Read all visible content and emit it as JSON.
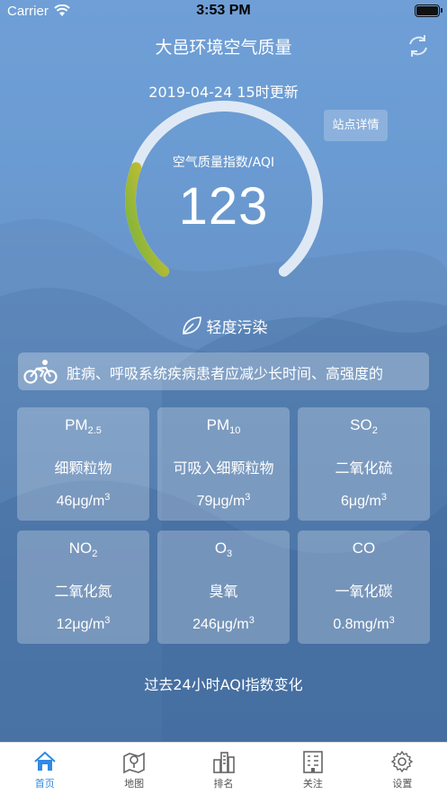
{
  "status_bar": {
    "carrier": "Carrier",
    "time": "3:53 PM"
  },
  "header": {
    "title": "大邑环境空气质量",
    "update_time": "2019-04-24 15时更新",
    "station_button": "站点详情"
  },
  "aqi": {
    "label": "空气质量指数/AQI",
    "value": "123",
    "level": "轻度污染",
    "gauge_fraction": 0.25
  },
  "advice": {
    "text": "脏病、呼吸系统疾病患者应减少长时间、高强度的"
  },
  "pollutants": [
    {
      "name": "PM",
      "sub": "2.5",
      "desc": "细颗粒物",
      "value": "46μg/m",
      "sup": "3"
    },
    {
      "name": "PM",
      "sub": "10",
      "desc": "可吸入细颗粒物",
      "value": "79μg/m",
      "sup": "3"
    },
    {
      "name": "SO",
      "sub": "2",
      "desc": "二氧化硫",
      "value": "6μg/m",
      "sup": "3"
    },
    {
      "name": "NO",
      "sub": "2",
      "desc": "二氧化氮",
      "value": "12μg/m",
      "sup": "3"
    },
    {
      "name": "O",
      "sub": "3",
      "desc": "臭氧",
      "value": "246μg/m",
      "sup": "3"
    },
    {
      "name": "CO",
      "sub": "",
      "desc": "一氧化碳",
      "value": "0.8mg/m",
      "sup": "3"
    }
  ],
  "chart": {
    "title": "过去24小时AQI指数变化"
  },
  "tabs": [
    {
      "label": "首页",
      "icon": "home-icon",
      "active": true
    },
    {
      "label": "地图",
      "icon": "map-icon",
      "active": false
    },
    {
      "label": "排名",
      "icon": "ranking-icon",
      "active": false
    },
    {
      "label": "关注",
      "icon": "building-icon",
      "active": false
    },
    {
      "label": "设置",
      "icon": "gear-icon",
      "active": false
    }
  ],
  "colors": {
    "accent": "#2f8ae5",
    "gauge_green": "#7cbf3a",
    "gauge_yellow": "#e6c22c"
  }
}
